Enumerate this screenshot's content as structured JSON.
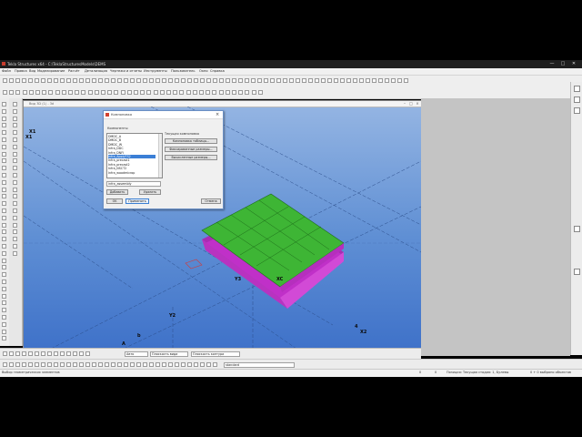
{
  "window": {
    "title": "Tekla Structures x64 - C:\\TeklaStructuresModels\\DEMS",
    "min": "—",
    "max": "□",
    "close": "✕"
  },
  "menu": [
    "Файл",
    "Правка",
    "Вид",
    "Моделирование",
    "Расчёт",
    "Детализация",
    "Чертежи и отчеты",
    "Инструменты",
    "Пользователь",
    "Окно",
    "Справка"
  ],
  "viewport": {
    "title": "Вид 3D (1) - 3d",
    "labels": {
      "x1": "X1",
      "y3": "Y3",
      "y2": "Y2",
      "x2": "X2",
      "xc": "XC",
      "b": "b",
      "a": "A",
      "four": "4"
    }
  },
  "dialog": {
    "title": "Компоновка",
    "section_label": "Компоненты",
    "current_label": "Текущая компоновка",
    "list": [
      "DMDC_A",
      "DMDC_B",
      "DMDC_W",
      "Infra_DDC",
      "Infra_DNFI",
      "Infra_ApplyTS2",
      "Infra_precast1",
      "Infra_precast2",
      "Infra_NSCT2",
      "Infra_woodmicrop"
    ],
    "selected_index": 5,
    "buttons": {
      "layout_table": "Компоновка таблицы...",
      "fixed_sizes": "Фиксированные размеры...",
      "calc_sizes": "Вычисленные размеры...",
      "add": "Добавить",
      "delete": "Удалить",
      "ok": "OK",
      "apply": "Применить",
      "cancel": "Отмена"
    },
    "name_value": "infra_assembly"
  },
  "bottom_toolbar": {
    "combo_auto": "Авто",
    "combo_plane": "Плоскость вида",
    "combo_snap": "Плоскость контура",
    "combo_standard": "standard"
  },
  "status": {
    "left": "Выбор геометрических элементов",
    "middle1": "0",
    "middle2": "0",
    "mode": "Позиция: Текущая стадия: 1, Булевы",
    "right": "0 + 0 выбрано объектов"
  },
  "colors": {
    "viewport_top": "#96b6e3",
    "viewport_bottom": "#3f72c9",
    "slab_green": "#3eb535",
    "slab_magenta": "#c030c8",
    "selection": "#3b7fd6"
  }
}
